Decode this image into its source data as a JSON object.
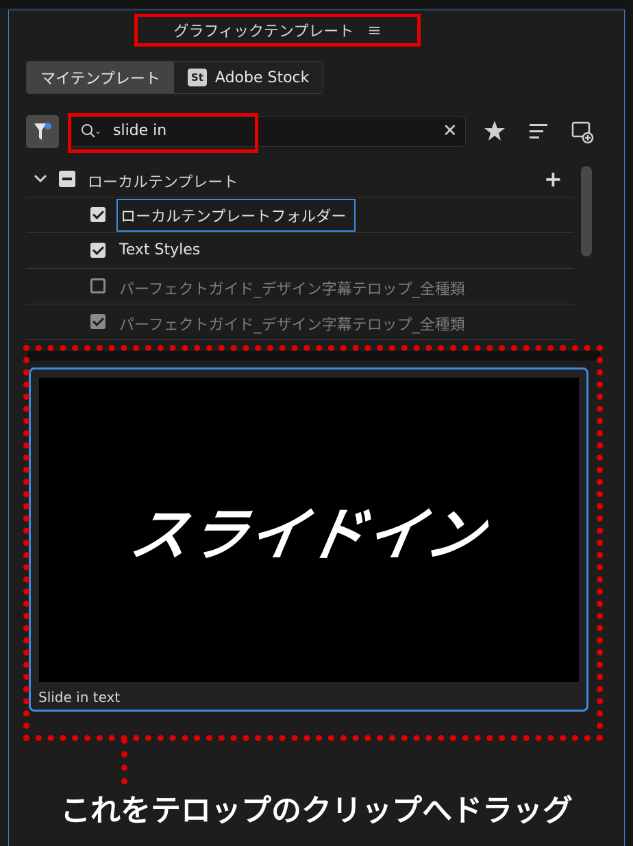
{
  "panel": {
    "title": "グラフィックテンプレート",
    "menu_icon": "hamburger-menu-icon"
  },
  "tabs": [
    {
      "label": "マイテンプレート",
      "active": true
    },
    {
      "label": "Adobe Stock",
      "badge": "St",
      "active": false
    }
  ],
  "search": {
    "value": "slide in"
  },
  "tree": {
    "root": {
      "label": "ローカルテンプレート"
    },
    "items": [
      {
        "label": "ローカルテンプレートフォルダー",
        "checked": true
      },
      {
        "label": "Text Styles",
        "checked": true
      },
      {
        "label": "パーフェクトガイド_デザイン字幕テロップ_全種類",
        "checked": false
      },
      {
        "label": "パーフェクトガイド_デザイン字幕テロップ_全種類",
        "checked": true
      }
    ]
  },
  "template": {
    "preview_text": "スライドイン",
    "name": "Slide in text"
  },
  "annotation": {
    "caption": "これをテロップのクリップへドラッグ"
  },
  "colors": {
    "highlight": "#e30000",
    "selection": "#3b8be0",
    "panel_bg": "#1d1d1d"
  }
}
